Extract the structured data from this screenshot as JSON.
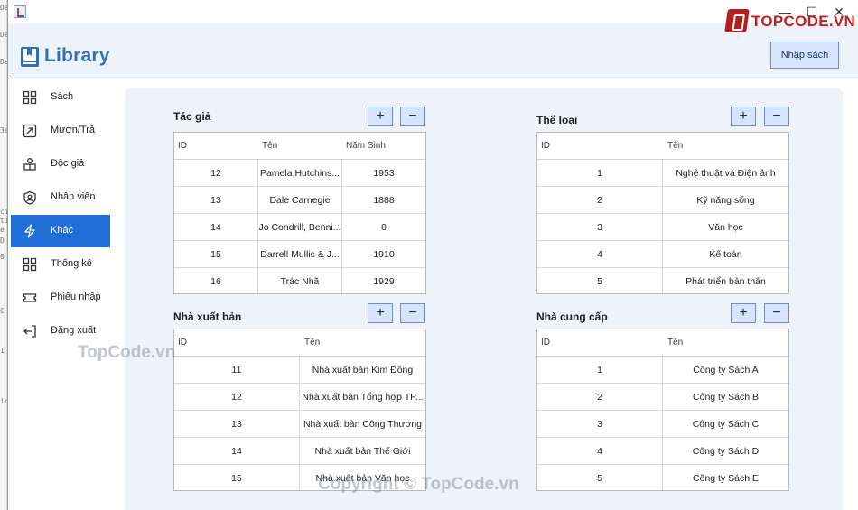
{
  "app": {
    "title": "Library",
    "import_button": "Nhập sách"
  },
  "sidebar": {
    "items": [
      {
        "label": "Sách",
        "icon": "grid-icon"
      },
      {
        "label": "Mượn/Trả",
        "icon": "arrow-box-icon"
      },
      {
        "label": "Độc giả",
        "icon": "user-group-icon"
      },
      {
        "label": "Nhân viên",
        "icon": "badge-icon"
      },
      {
        "label": "Khác",
        "icon": "bolt-icon",
        "active": true
      },
      {
        "label": "Thống kê",
        "icon": "grid-icon"
      },
      {
        "label": "Phiếu nhập",
        "icon": "ticket-icon"
      },
      {
        "label": "Đăng xuất",
        "icon": "logout-icon"
      }
    ]
  },
  "panels": {
    "authors": {
      "title": "Tác giả",
      "add": "+",
      "remove": "−",
      "columns": [
        "ID",
        "Tên",
        "Năm Sinh"
      ],
      "rows": [
        [
          "12",
          "Pamela Hutchins...",
          "1953"
        ],
        [
          "13",
          "Dale Carnegie",
          "1888"
        ],
        [
          "14",
          "Jo Condrill, Benni...",
          "0"
        ],
        [
          "15",
          "Darrell Mullis & J...",
          "1910"
        ],
        [
          "16",
          "Trác Nhã",
          "1929"
        ]
      ]
    },
    "genres": {
      "title": "Thể loại",
      "add": "+",
      "remove": "−",
      "columns": [
        "ID",
        "Tên"
      ],
      "rows": [
        [
          "1",
          "Nghệ thuật và Điện ảnh"
        ],
        [
          "2",
          "Kỹ năng sống"
        ],
        [
          "3",
          "Văn học"
        ],
        [
          "4",
          "Kế toán"
        ],
        [
          "5",
          "Phát triển bản thân"
        ]
      ]
    },
    "publishers": {
      "title": "Nhà xuất bản",
      "add": "+",
      "remove": "−",
      "columns": [
        "ID",
        "Tên"
      ],
      "rows": [
        [
          "11",
          "Nhà xuất bản Kim Đồng"
        ],
        [
          "12",
          "Nhà xuất bản Tổng hợp TP..."
        ],
        [
          "13",
          "Nhà xuất bản Công Thương"
        ],
        [
          "14",
          "Nhà xuất bản Thế Giới"
        ],
        [
          "15",
          "Nhà xuất bản Văn học"
        ]
      ]
    },
    "suppliers": {
      "title": "Nhà cung cấp",
      "add": "+",
      "remove": "−",
      "columns": [
        "ID",
        "Tên"
      ],
      "rows": [
        [
          "1",
          "Công ty Sách A"
        ],
        [
          "2",
          "Công ty Sách B"
        ],
        [
          "3",
          "Công ty Sách C"
        ],
        [
          "4",
          "Công ty Sách D"
        ],
        [
          "5",
          "Công ty Sách E"
        ]
      ]
    }
  },
  "window": {
    "minimize": "—",
    "maximize": "☐",
    "close": "✕"
  },
  "watermarks": {
    "brand": "TOPCODE.VN",
    "site": "TopCode.vn",
    "copyright": "Copyright © TopCode.vn"
  },
  "background_strip": [
    "Da",
    "Da",
    "Da",
    "3s",
    "ci",
    "ti",
    "e",
    "D",
    "0",
    "C",
    "1",
    "ic"
  ],
  "colors": {
    "accent": "#1f6fd6",
    "logo": "#2f6fb8",
    "button_bg": "#d7e4fb",
    "button_border": "#6d8fc7",
    "content_bg": "#eef3fb"
  }
}
